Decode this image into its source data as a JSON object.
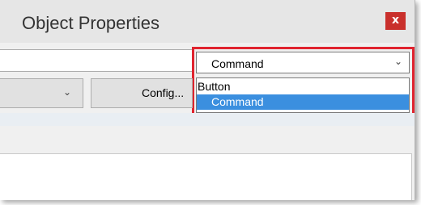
{
  "window": {
    "title": "Object Properties",
    "close_label": "x"
  },
  "command_combo": {
    "selected_value": "Command",
    "options": [
      "Button",
      "Command"
    ],
    "highlighted_option": "Command"
  },
  "config_button": {
    "label": "Config..."
  },
  "colors": {
    "close_button": "#c9302c",
    "highlight_border": "#e0242f",
    "selected_option": "#3b8fdf"
  },
  "icons": {
    "dropdown": "chevron-down-icon"
  }
}
